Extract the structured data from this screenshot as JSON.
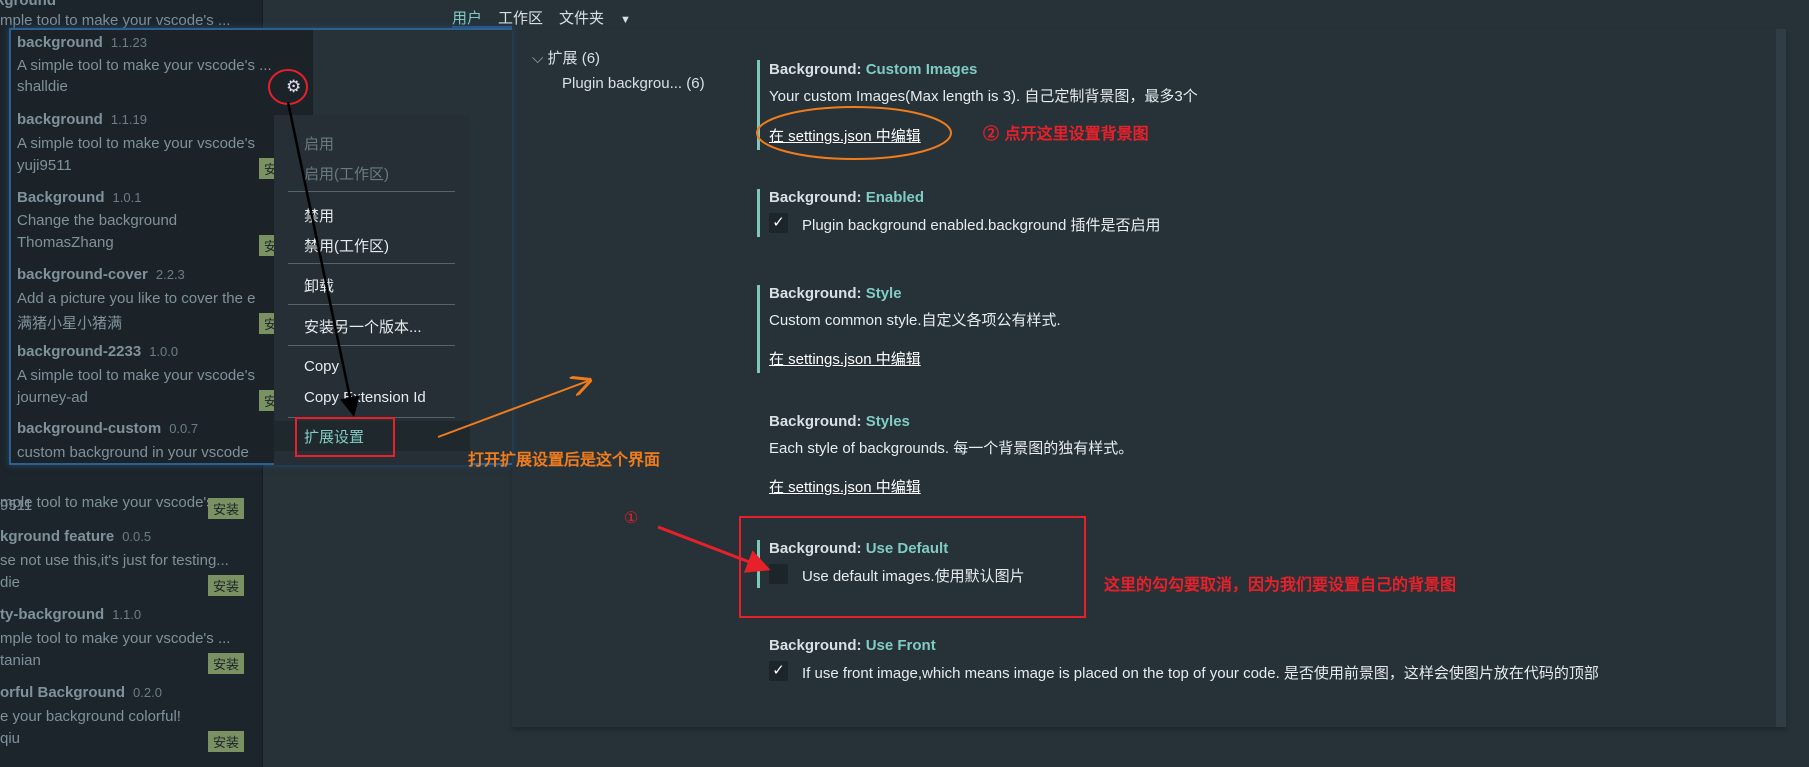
{
  "header": {
    "tabs": [
      "用户",
      "工作区",
      "文件夹"
    ],
    "dropdown_icon": "caret-down-icon"
  },
  "sidebar": {
    "items": [
      {
        "name": "background",
        "version": "1.1.23",
        "desc": "A simple tool to make your vscode's ...",
        "author": "shalldie"
      },
      {
        "name": "background",
        "version": "1.1.19",
        "desc": "A simple tool to make your vscode's",
        "author": "yuji9511",
        "badge": "安装"
      },
      {
        "name": "Background",
        "version": "1.0.1",
        "desc": "Change the background",
        "author": "ThomasZhang",
        "badge": "安装"
      },
      {
        "name": "background-cover",
        "version": "2.2.3",
        "desc": "Add a picture you like to cover the e",
        "author": "满猪小星小猪满",
        "badge": "安装"
      },
      {
        "name": "background-2233",
        "version": "1.0.0",
        "desc": "A simple tool to make your vscode's",
        "author": "journey-ad",
        "badge": "安装"
      },
      {
        "name": "background-custom",
        "version": "0.0.7",
        "desc": "custom background in your vscode"
      }
    ],
    "behind_items": [
      {
        "desc": "mple tool to make your vscode's ...",
        "author": "9511",
        "badge": "安装"
      },
      {
        "name": "kground feature",
        "version": "0.0.5",
        "desc": "se not use this,it's just for testing...",
        "author": "die",
        "badge": "安装"
      },
      {
        "name": "ty-background",
        "version": "1.1.0",
        "desc": "mple tool to make your vscode's ...",
        "author": "tanian",
        "badge": "安装"
      },
      {
        "name": "orful Background",
        "version": "0.2.0",
        "desc": "e your background colorful!",
        "author": "qiu",
        "badge": "安装"
      }
    ]
  },
  "context_menu": {
    "items": [
      "启用",
      "启用(工作区)",
      "禁用",
      "禁用(工作区)",
      "卸载",
      "安装另一个版本...",
      "Copy",
      "Copy Extension Id",
      "扩展设置"
    ]
  },
  "tree": {
    "group": "扩展 (6)",
    "child": "Plugin backgrou... (6)"
  },
  "settings": [
    {
      "prefix": "Background: ",
      "key": "Custom Images",
      "desc": "Your custom Images(Max length is 3). 自己定制背景图，最多3个",
      "link": "在 settings.json 中编辑"
    },
    {
      "prefix": "Background: ",
      "key": "Enabled",
      "desc": "Plugin background enabled.background 插件是否启用",
      "checked": true
    },
    {
      "prefix": "Background: ",
      "key": "Style",
      "desc": "Custom common style.自定义各项公有样式.",
      "link": "在 settings.json 中编辑"
    },
    {
      "prefix": "Background: ",
      "key": "Styles",
      "desc": "Each style of backgrounds. 每一个背景图的独有样式。",
      "link": "在 settings.json 中编辑"
    },
    {
      "prefix": "Background: ",
      "key": "Use Default",
      "desc": "Use default images.使用默认图片",
      "checked": false
    },
    {
      "prefix": "Background: ",
      "key": "Use Front",
      "desc": "If use front image,which means image is placed on the top of your code. 是否使用前景图，这样会使图片放在代码的顶部",
      "checked": true
    }
  ],
  "annotations": {
    "open_settings": "打开扩展设置后是这个界面",
    "step2": "② 点开这里设置背景图",
    "step1": "①",
    "uncheck": "这里的勾勾要取消，因为我们要设置自己的背景图"
  },
  "colors": {
    "accent": "#80cbc4",
    "badge": "#7a9262",
    "annotation_red": "#e8202a",
    "annotation_orange": "#f07c1c"
  }
}
